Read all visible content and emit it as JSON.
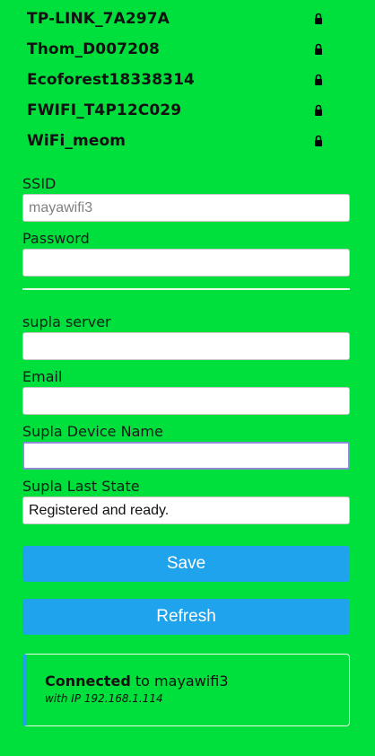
{
  "networks": [
    {
      "ssid": "TP-LINK_7A297A",
      "secured": true
    },
    {
      "ssid": "Thom_D007208",
      "secured": true
    },
    {
      "ssid": "Ecoforest18338314",
      "secured": true
    },
    {
      "ssid": "FWIFI_T4P12C029",
      "secured": true
    },
    {
      "ssid": "WiFi_meom",
      "secured": true
    }
  ],
  "form": {
    "ssid_label": "SSID",
    "ssid_placeholder": "mayawifi3",
    "ssid_value": "",
    "password_label": "Password",
    "password_value": "",
    "server_label": "supla server",
    "server_value": "",
    "email_label": "Email",
    "email_value": "",
    "device_name_label": "Supla Device Name",
    "device_name_value": "",
    "last_state_label": "Supla Last State",
    "last_state_value": "Registered and ready."
  },
  "buttons": {
    "save": "Save",
    "refresh": "Refresh"
  },
  "status": {
    "connected_word": "Connected",
    "to_text": " to mayawifi3",
    "ip_text": "with IP 192.168.1.114"
  },
  "colors": {
    "background": "#00e03c",
    "button": "#1fa3ec",
    "lock_icon": "#000000"
  }
}
